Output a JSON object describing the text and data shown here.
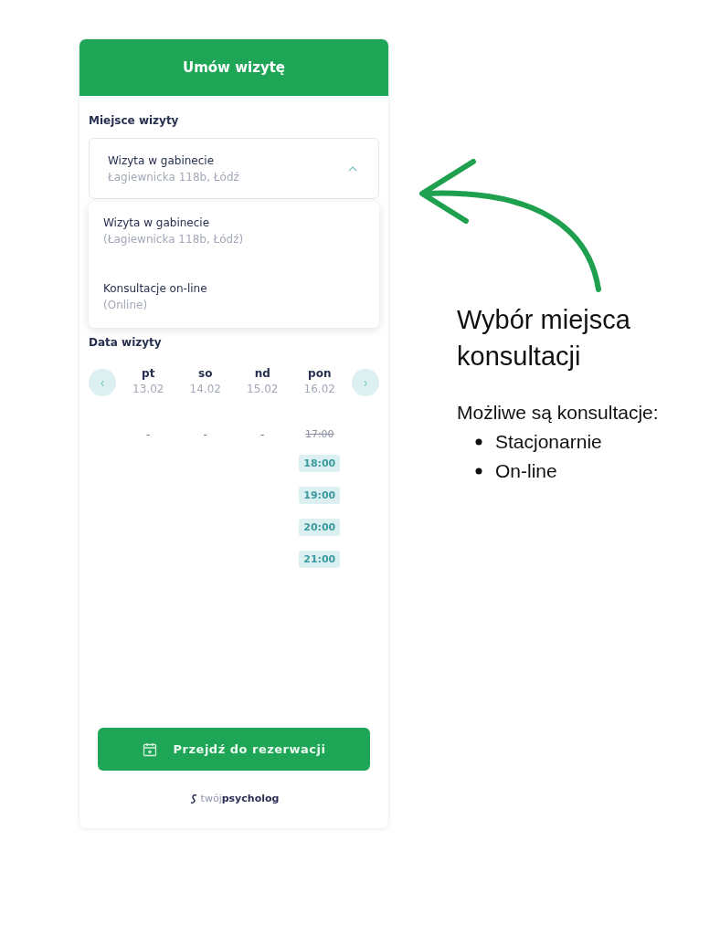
{
  "widget": {
    "title": "Umów wizytę",
    "place_label": "Miejsce wizyty",
    "select": {
      "value": "Wizyta w gabinecie",
      "detail": "Łagiewnicka 118b, Łódź",
      "expanded": true
    },
    "options": [
      {
        "label": "Wizyta w gabinecie",
        "detail": "(Łagiewnicka 118b, Łódź)"
      },
      {
        "label": "Konsultacje on-line",
        "detail": "(Online)"
      }
    ],
    "date_label": "Data wizyty",
    "days": [
      {
        "name": "pt",
        "date": "13.02",
        "slots": [
          {
            "time": "-",
            "kind": "none"
          }
        ]
      },
      {
        "name": "so",
        "date": "14.02",
        "slots": [
          {
            "time": "-",
            "kind": "none"
          }
        ]
      },
      {
        "name": "nd",
        "date": "15.02",
        "slots": [
          {
            "time": "-",
            "kind": "none"
          }
        ]
      },
      {
        "name": "pon",
        "date": "16.02",
        "slots": [
          {
            "time": "17:00",
            "kind": "taken"
          },
          {
            "time": "18:00",
            "kind": "free"
          },
          {
            "time": "19:00",
            "kind": "free"
          },
          {
            "time": "20:00",
            "kind": "free"
          },
          {
            "time": "21:00",
            "kind": "free"
          }
        ]
      }
    ],
    "prev": "‹",
    "next": "›",
    "button": "Przejdź do rezerwacji",
    "brand": {
      "light": "twój",
      "bold": "psycholog"
    }
  },
  "annotation": {
    "title": "Wybór miejsca konsultacji",
    "intro": "Możliwe są konsultacje:",
    "items": [
      "Stacjonarnie",
      "On-line"
    ]
  }
}
